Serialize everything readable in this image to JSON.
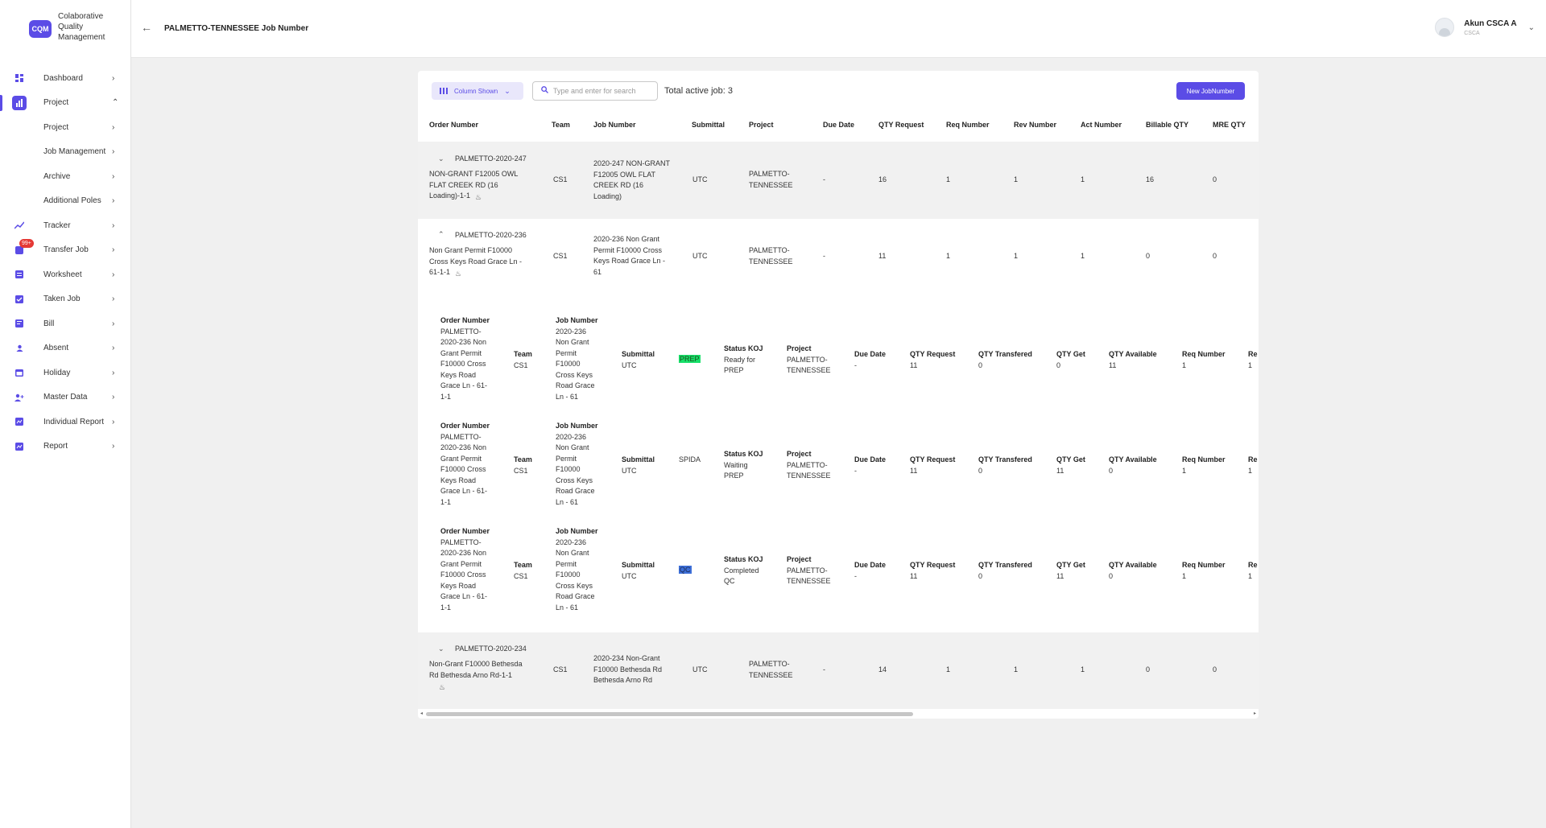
{
  "app": {
    "logo": "CQM",
    "name": "Colaborative Quality Management"
  },
  "sidebar": {
    "items": [
      {
        "label": "Dashboard",
        "icon": "dashboard-icon"
      },
      {
        "label": "Project",
        "icon": "chart-icon",
        "expanded": true
      },
      {
        "label": "Project",
        "sub": true
      },
      {
        "label": "Job Management",
        "sub": true
      },
      {
        "label": "Archive",
        "sub": true
      },
      {
        "label": "Additional Poles",
        "sub": true
      },
      {
        "label": "Tracker",
        "icon": "trend-icon"
      },
      {
        "label": "Transfer Job",
        "icon": "transfer-icon",
        "badge": "99+"
      },
      {
        "label": "Worksheet",
        "icon": "worksheet-icon"
      },
      {
        "label": "Taken Job",
        "icon": "check-icon"
      },
      {
        "label": "Bill",
        "icon": "bill-icon"
      },
      {
        "label": "Absent",
        "icon": "absent-icon"
      },
      {
        "label": "Holiday",
        "icon": "calendar-icon"
      },
      {
        "label": "Master Data",
        "icon": "user-add-icon"
      },
      {
        "label": "Individual Report",
        "icon": "report-icon"
      },
      {
        "label": "Report",
        "icon": "report2-icon"
      }
    ]
  },
  "header": {
    "title": "PALMETTO-TENNESSEE Job Number",
    "user_name": "Akun CSCA A",
    "user_role": "CSCA"
  },
  "toolbar": {
    "column_shown": "Column Shown",
    "search_placeholder": "Type and enter for search",
    "total": "Total active job: 3",
    "new_button": "New JobNumber"
  },
  "table": {
    "headers": [
      "Order Number",
      "Team",
      "Job Number",
      "Submittal",
      "Project",
      "Due Date",
      "QTY Request",
      "Req Number",
      "Rev Number",
      "Act Number",
      "Billable QTY",
      "MRE QTY"
    ],
    "rows": [
      {
        "order_id": "PALMETTO-2020-247",
        "order_desc": "NON-GRANT F12005 OWL FLAT CREEK RD (16 Loading)-1-1",
        "team": "CS1",
        "job": "2020-247 NON-GRANT F12005 OWL FLAT CREEK RD (16 Loading)",
        "submittal": "UTC",
        "project": "PALMETTO-TENNESSEE",
        "due": "-",
        "qty_req": "16",
        "req": "1",
        "rev": "1",
        "act": "1",
        "billable": "16",
        "mre": "0",
        "expanded": false
      },
      {
        "order_id": "PALMETTO-2020-236",
        "order_desc": "Non Grant Permit F10000 Cross Keys Road Grace Ln - 61-1-1",
        "team": "CS1",
        "job": "2020-236 Non Grant Permit F10000 Cross Keys Road Grace Ln - 61",
        "submittal": "UTC",
        "project": "PALMETTO-TENNESSEE",
        "due": "-",
        "qty_req": "11",
        "req": "1",
        "rev": "1",
        "act": "1",
        "billable": "0",
        "mre": "0",
        "expanded": true
      },
      {
        "order_id": "PALMETTO-2020-234",
        "order_desc": "Non-Grant F10000 Bethesda Rd Bethesda Arno Rd-1-1",
        "team": "CS1",
        "job": "2020-234 Non-Grant F10000 Bethesda Rd Bethesda Arno Rd",
        "submittal": "UTC",
        "project": "PALMETTO-TENNESSEE",
        "due": "-",
        "qty_req": "14",
        "req": "1",
        "rev": "1",
        "act": "1",
        "billable": "0",
        "mre": "0",
        "expanded": false
      }
    ]
  },
  "subtable": {
    "headers": {
      "order": "Order Number",
      "team": "Team",
      "job": "Job Number",
      "submittal": "Submittal",
      "status_koj": "Status KOJ",
      "project": "Project",
      "due": "Due Date",
      "qty_req": "QTY Request",
      "qty_trans": "QTY Transfered",
      "qty_get": "QTY Get",
      "qty_avail": "QTY Available",
      "req": "Req Number",
      "rev_partial": "Re"
    },
    "rows": [
      {
        "order": "PALMETTO-2020-236 Non Grant Permit F10000 Cross Keys Road Grace Ln - 61-1-1",
        "team": "CS1",
        "job": "2020-236 Non Grant Permit F10000 Cross Keys Road Grace Ln - 61",
        "submittal": "UTC",
        "tag": "PREP",
        "status": "Ready for PREP",
        "project": "PALMETTO-TENNESSEE",
        "due": "-",
        "qty_req": "11",
        "qty_trans": "0",
        "qty_get": "0",
        "qty_avail": "11",
        "req": "1",
        "rev": "1"
      },
      {
        "order": "PALMETTO-2020-236 Non Grant Permit F10000 Cross Keys Road Grace Ln - 61-1-1",
        "team": "CS1",
        "job": "2020-236 Non Grant Permit F10000 Cross Keys Road Grace Ln - 61",
        "submittal": "UTC",
        "tag": "SPIDA",
        "status": "Waiting PREP",
        "project": "PALMETTO-TENNESSEE",
        "due": "-",
        "qty_req": "11",
        "qty_trans": "0",
        "qty_get": "11",
        "qty_avail": "0",
        "req": "1",
        "rev": "1"
      },
      {
        "order": "PALMETTO-2020-236 Non Grant Permit F10000 Cross Keys Road Grace Ln - 61-1-1",
        "team": "CS1",
        "job": "2020-236 Non Grant Permit F10000 Cross Keys Road Grace Ln - 61",
        "submittal": "UTC",
        "tag": "QC",
        "status": "Completed QC",
        "project": "PALMETTO-TENNESSEE",
        "due": "-",
        "qty_req": "11",
        "qty_trans": "0",
        "qty_get": "11",
        "qty_avail": "0",
        "req": "1",
        "rev": "1"
      }
    ]
  },
  "colors": {
    "accent": "#5b4ce6",
    "prep": "#18e06a",
    "qc": "#3d6fd8",
    "badge": "#e53935"
  }
}
